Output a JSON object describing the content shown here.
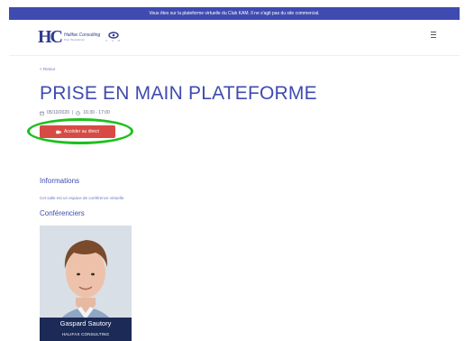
{
  "banner": {
    "text": "Vous êtes sur la plateforme virtuelle du Club KAM. Il ne s'agit pas du site commercial."
  },
  "logo": {
    "mark": "HC",
    "name": "Halifax Consulting",
    "sub": "Pour l'Excellence",
    "partner": "K A M"
  },
  "back_link": "< Retour",
  "page_title": "PRISE EN MAIN PLATEFORME",
  "event": {
    "date": "05/10/2020",
    "separator": "|",
    "time": "16:30 - 17:00"
  },
  "join_button": "Accéder au direct",
  "sections": {
    "informations_title": "Informations",
    "informations_text": "Cet salle est un espace de conférence virtuelle.",
    "speakers_title": "Conférenciers"
  },
  "speaker": {
    "name": "Gaspard Sautory",
    "company": "HALIFAX CONSULTING"
  },
  "colors": {
    "accent": "#3f4bb0",
    "button": "#d84a44",
    "highlight": "#1ec01e",
    "card_footer": "#1b2a56"
  }
}
